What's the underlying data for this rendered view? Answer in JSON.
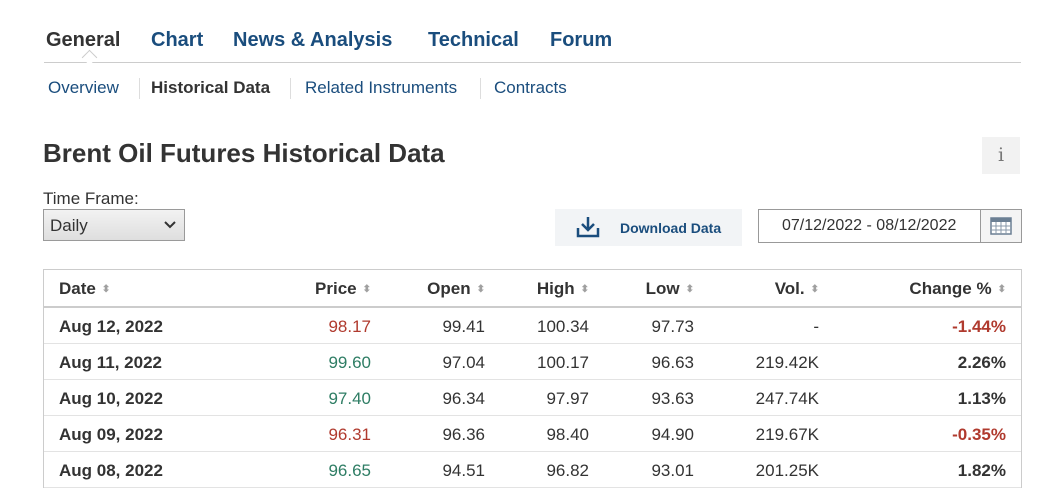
{
  "tabs": [
    {
      "label": "General",
      "active": true
    },
    {
      "label": "Chart",
      "active": false
    },
    {
      "label": "News & Analysis",
      "active": false
    },
    {
      "label": "Technical",
      "active": false
    },
    {
      "label": "Forum",
      "active": false
    }
  ],
  "subnav": [
    {
      "label": "Overview",
      "active": false
    },
    {
      "label": "Historical Data",
      "active": true
    },
    {
      "label": "Related Instruments",
      "active": false
    },
    {
      "label": "Contracts",
      "active": false
    }
  ],
  "page_title": "Brent Oil Futures Historical Data",
  "info_icon": "i",
  "time_frame": {
    "label": "Time Frame:",
    "selected": "Daily"
  },
  "download": {
    "label": "Download Data",
    "icon": "download-icon"
  },
  "date_range": {
    "value": "07/12/2022 - 08/12/2022",
    "icon": "calendar-icon"
  },
  "table": {
    "columns": [
      "Date",
      "Price",
      "Open",
      "High",
      "Low",
      "Vol.",
      "Change %"
    ],
    "rows": [
      {
        "date": "Aug 12, 2022",
        "price": "98.17",
        "open": "99.41",
        "high": "100.34",
        "low": "97.73",
        "vol": "-",
        "change": "-1.44%",
        "direction": "down"
      },
      {
        "date": "Aug 11, 2022",
        "price": "99.60",
        "open": "97.04",
        "high": "100.17",
        "low": "96.63",
        "vol": "219.42K",
        "change": "2.26%",
        "direction": "up"
      },
      {
        "date": "Aug 10, 2022",
        "price": "97.40",
        "open": "96.34",
        "high": "97.97",
        "low": "93.63",
        "vol": "247.74K",
        "change": "1.13%",
        "direction": "up"
      },
      {
        "date": "Aug 09, 2022",
        "price": "96.31",
        "open": "96.36",
        "high": "98.40",
        "low": "94.90",
        "vol": "219.67K",
        "change": "-0.35%",
        "direction": "down"
      },
      {
        "date": "Aug 08, 2022",
        "price": "96.65",
        "open": "94.51",
        "high": "96.82",
        "low": "93.01",
        "vol": "201.25K",
        "change": "1.82%",
        "direction": "up"
      }
    ]
  },
  "colors": {
    "link": "#1a4d7d",
    "up": "#2e7d64",
    "down": "#b03a2e",
    "text": "#333333"
  }
}
